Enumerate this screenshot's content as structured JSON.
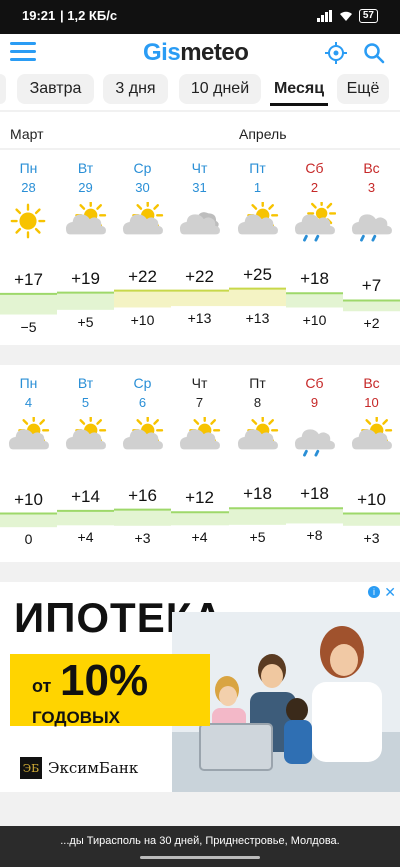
{
  "status": {
    "time": "19:21",
    "speed": "| 1,2 КБ/с",
    "battery": "57"
  },
  "header": {
    "logo_a": "Gis",
    "logo_b": "meteo"
  },
  "tabs": [
    {
      "label": "Завтра",
      "active": false
    },
    {
      "label": "3 дня",
      "active": false
    },
    {
      "label": "10 дней",
      "active": false
    },
    {
      "label": "Месяц",
      "active": true
    },
    {
      "label": "Ещё",
      "active": false
    }
  ],
  "months": {
    "left": "Март",
    "right": "Апрель"
  },
  "weeks": [
    {
      "days": [
        {
          "name": "Пн",
          "num": "28",
          "color": "blue",
          "icon": "sun",
          "max": "+17",
          "min": "−5",
          "max_v": 17,
          "min_v": -5
        },
        {
          "name": "Вт",
          "num": "29",
          "color": "blue",
          "icon": "cloud-sun",
          "max": "+19",
          "min": "+5",
          "max_v": 19,
          "min_v": 5
        },
        {
          "name": "Ср",
          "num": "30",
          "color": "blue",
          "icon": "cloud-sun",
          "max": "+22",
          "min": "+10",
          "max_v": 22,
          "min_v": 10
        },
        {
          "name": "Чт",
          "num": "31",
          "color": "blue",
          "icon": "cloudy",
          "max": "+22",
          "min": "+13",
          "max_v": 22,
          "min_v": 13
        },
        {
          "name": "Пт",
          "num": "1",
          "color": "blue",
          "icon": "cloud-sun",
          "max": "+25",
          "min": "+13",
          "max_v": 25,
          "min_v": 13
        },
        {
          "name": "Сб",
          "num": "2",
          "color": "red",
          "icon": "rain-sun",
          "max": "+18",
          "min": "+10",
          "max_v": 18,
          "min_v": 10
        },
        {
          "name": "Вс",
          "num": "3",
          "color": "red",
          "icon": "rain",
          "max": "+7",
          "min": "+2",
          "max_v": 7,
          "min_v": 2
        }
      ]
    },
    {
      "days": [
        {
          "name": "Пн",
          "num": "4",
          "color": "blue",
          "icon": "cloud-sun",
          "max": "+10",
          "min": "0",
          "max_v": 10,
          "min_v": 0
        },
        {
          "name": "Вт",
          "num": "5",
          "color": "blue",
          "icon": "cloud-sun",
          "max": "+14",
          "min": "+4",
          "max_v": 14,
          "min_v": 4
        },
        {
          "name": "Ср",
          "num": "6",
          "color": "blue",
          "icon": "cloud-sun",
          "max": "+16",
          "min": "+3",
          "max_v": 16,
          "min_v": 3
        },
        {
          "name": "Чт",
          "num": "7",
          "color": "black",
          "icon": "cloud-sun",
          "max": "+12",
          "min": "+4",
          "max_v": 12,
          "min_v": 4
        },
        {
          "name": "Пт",
          "num": "8",
          "color": "black",
          "icon": "cloud-sun",
          "max": "+18",
          "min": "+5",
          "max_v": 18,
          "min_v": 5
        },
        {
          "name": "Сб",
          "num": "9",
          "color": "red",
          "icon": "rain",
          "max": "+18",
          "min": "+8",
          "max_v": 18,
          "min_v": 8
        },
        {
          "name": "Вс",
          "num": "10",
          "color": "red",
          "icon": "cloud-sun",
          "max": "+10",
          "min": "+3",
          "max_v": 10,
          "min_v": 3
        }
      ]
    }
  ],
  "ad": {
    "title": "ИПОТЕКА",
    "from": "от",
    "percent": "10%",
    "sub": "ГОДОВЫХ",
    "bank_logo": "ЭБ",
    "bank": "ЭксимБанк"
  },
  "footer": {
    "text": "...ды Тирасполь на 30 дней, Приднестровье, Молдова."
  },
  "colors": {
    "accent": "#2a9cf4",
    "sun": "#f7c300",
    "cloud": "#d0d0d0",
    "rain": "#2a8fd6"
  }
}
